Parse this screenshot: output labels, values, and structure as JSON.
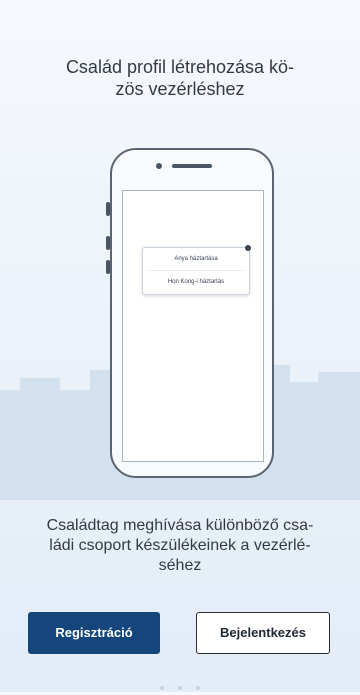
{
  "onboarding": {
    "title": "Család profil létrehozása kö-\nzös vezérléshez",
    "subtitle": "Családtag meghívása különböző csa-\nládi csoport készülékeinek a vezérlé-\nséhez"
  },
  "illustration": {
    "dropdown_items": [
      "Anya háztartása",
      "Hon Kong-i háztartás"
    ]
  },
  "buttons": {
    "register_label": "Regisztráció",
    "login_label": "Bejelentkezés"
  },
  "pager": {
    "page_count": 3,
    "active_index": 0
  },
  "colors": {
    "primary": "#14457b",
    "text": "#333a44",
    "city": "#d3e1ef"
  }
}
